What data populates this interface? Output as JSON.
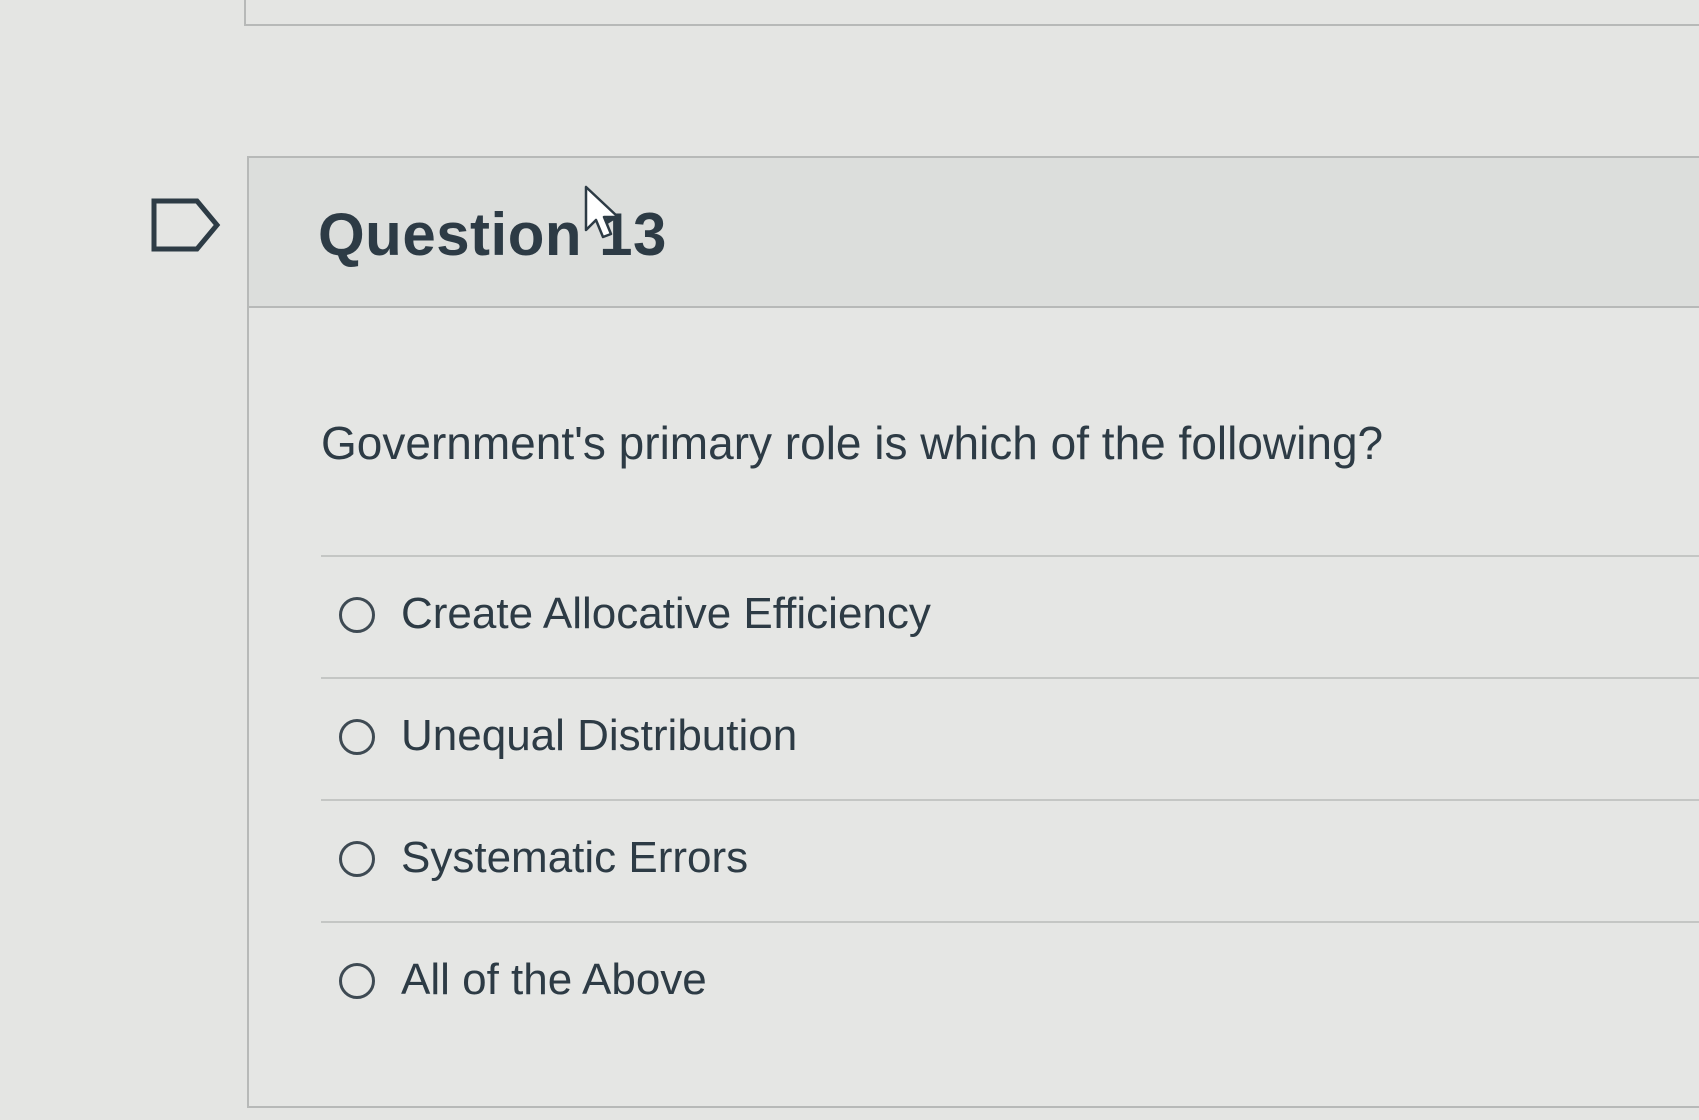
{
  "question": {
    "title": "Question 13",
    "text": "Government's primary role is which of the following?",
    "flag_icon": "flag-outline-icon",
    "answers": [
      {
        "label": "Create Allocative Efficiency",
        "selected": false
      },
      {
        "label": "Unequal Distribution",
        "selected": false
      },
      {
        "label": "Systematic Errors",
        "selected": false
      },
      {
        "label": "All of the Above",
        "selected": false
      }
    ]
  },
  "cursor": {
    "icon": "mouse-pointer-icon"
  }
}
